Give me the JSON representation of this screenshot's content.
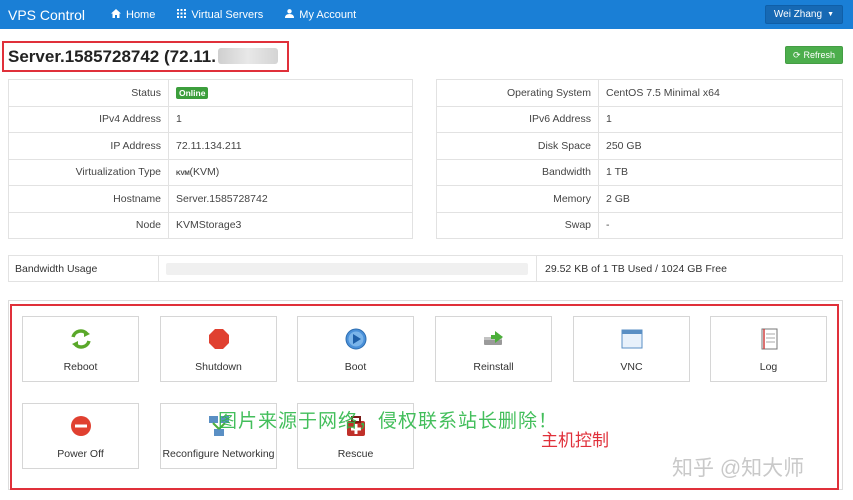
{
  "navbar": {
    "brand": "VPS Control",
    "items": [
      {
        "label": "Home",
        "icon": "home-icon"
      },
      {
        "label": "Virtual Servers",
        "icon": "grid-icon"
      },
      {
        "label": "My Account",
        "icon": "user-icon"
      }
    ],
    "user": "Wei Zhang"
  },
  "title": "Server.1585728742 (72.11.",
  "refresh_label": "Refresh",
  "left_table": [
    {
      "key": "Status",
      "value": "Online"
    },
    {
      "key": "IPv4 Address",
      "value": "1"
    },
    {
      "key": "IP Address",
      "value": "72.11.134.211"
    },
    {
      "key": "Virtualization Type",
      "value": "(KVM)",
      "logo_text": "KVM"
    },
    {
      "key": "Hostname",
      "value": "Server.1585728742"
    },
    {
      "key": "Node",
      "value": "KVMStorage3"
    }
  ],
  "right_table": [
    {
      "key": "Operating System",
      "value": "CentOS 7.5 Minimal x64"
    },
    {
      "key": "IPv6 Address",
      "value": "1"
    },
    {
      "key": "Disk Space",
      "value": "250 GB"
    },
    {
      "key": "Bandwidth",
      "value": "1 TB"
    },
    {
      "key": "Memory",
      "value": "2 GB"
    },
    {
      "key": "Swap",
      "value": "-"
    }
  ],
  "bandwidth": {
    "label": "Bandwidth Usage",
    "text": "29.52 KB of 1 TB Used / 1024 GB Free",
    "used_fraction": 0.0
  },
  "controls": [
    {
      "label": "Reboot",
      "icon": "reboot-icon"
    },
    {
      "label": "Shutdown",
      "icon": "shutdown-icon"
    },
    {
      "label": "Boot",
      "icon": "boot-icon"
    },
    {
      "label": "Reinstall",
      "icon": "reinstall-icon"
    },
    {
      "label": "VNC",
      "icon": "vnc-icon"
    },
    {
      "label": "Log",
      "icon": "log-icon"
    },
    {
      "label": "Power Off",
      "icon": "power-off-icon"
    },
    {
      "label": "Reconfigure Networking",
      "icon": "network-icon"
    },
    {
      "label": "Rescue",
      "icon": "rescue-icon"
    }
  ],
  "watermark": {
    "green": "图片来源于网络，侵权联系站长删除！",
    "red": "主机控制",
    "zhihu": "知乎 @知大师"
  },
  "colors": {
    "navbar": "#1a7fd6",
    "online": "#3c9e3c",
    "refresh": "#4cae4c",
    "highlight": "#e0303a"
  }
}
